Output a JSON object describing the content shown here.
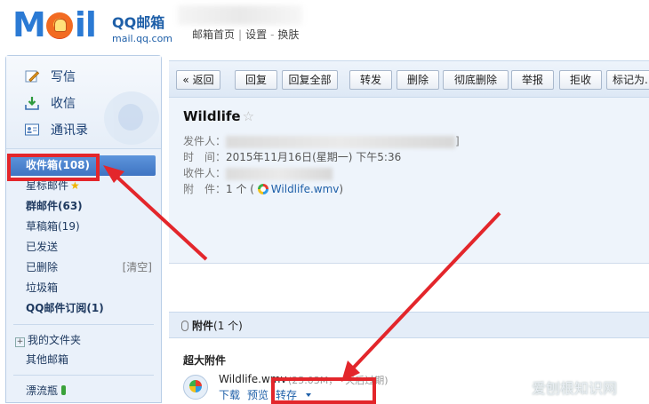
{
  "header": {
    "logo_text": "MOil",
    "brand_title": "QQ邮箱",
    "brand_url": "mail.qq.com",
    "links": [
      "邮箱首页",
      "设置",
      "换肤"
    ]
  },
  "sidebar": {
    "actions": [
      {
        "label": "写信",
        "icon": "pen-icon"
      },
      {
        "label": "收信",
        "icon": "inbox-download-icon"
      },
      {
        "label": "通讯录",
        "icon": "contacts-card-icon"
      }
    ],
    "folders": [
      {
        "label": "收件箱(108)"
      },
      {
        "label": "星标邮件"
      },
      {
        "label": "群邮件(63)"
      },
      {
        "label": "草稿箱(19)"
      },
      {
        "label": "已发送"
      },
      {
        "label": "已删除",
        "extra": "[清空]"
      },
      {
        "label": "垃圾箱"
      },
      {
        "label": "QQ邮件订阅(1)"
      }
    ],
    "sections": [
      "我的文件夹",
      "其他邮箱",
      "漂流瓶"
    ],
    "expand_symbol": "+"
  },
  "toolbar": {
    "buttons": [
      "« 返回",
      "回复",
      "回复全部",
      "转发",
      "删除",
      "彻底删除",
      "举报",
      "拒收",
      "标记为..."
    ]
  },
  "mail": {
    "subject": "Wildlife",
    "star": "☆",
    "from_label": "发件人：",
    "time_label": "时　间：",
    "time_value": "2015年11月16日(星期一) 下午5:36",
    "to_label": "收件人：",
    "attach_label": "附　件：",
    "attach_prefix": "1 个 (",
    "attach_file": "Wildlife.wmv",
    "attach_suffix": ")",
    "from_bracket": "]"
  },
  "attachments": {
    "title": "附件",
    "count": "(1 个)",
    "big_label": "超大附件",
    "file_name": "Wildlife.wmv",
    "file_size": "(25.03M，",
    "file_expiry": "天后过期)",
    "actions": [
      "下载",
      "预览",
      "转存"
    ]
  },
  "watermark": "爱刨根知识网",
  "colors": {
    "highlight": "#e3262b",
    "brand_blue": "#2b7ad4",
    "active_folder": "#4a83cf"
  }
}
